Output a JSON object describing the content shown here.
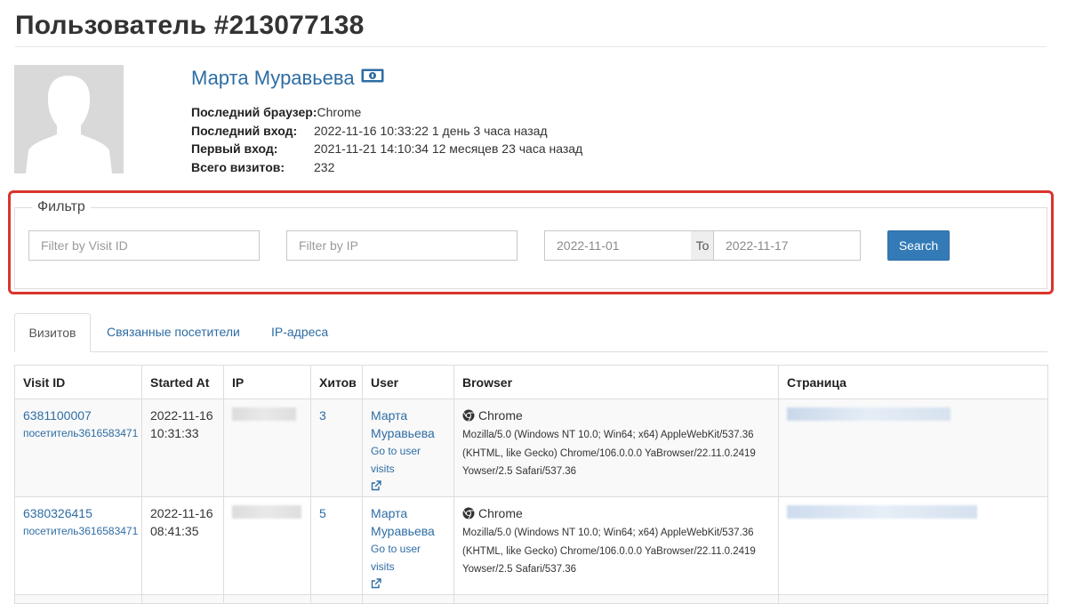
{
  "page": {
    "title": "Пользователь #213077138"
  },
  "user": {
    "name": "Марта Муравьева",
    "info": [
      {
        "label": "Последний браузер:",
        "value": "Chrome"
      },
      {
        "label": "Последний вход:",
        "value": "2022-11-16 10:33:22 1 день 3 часа назад"
      },
      {
        "label": "Первый вход:",
        "value": "2021-11-21 14:10:34 12 месяцев 23 часа назад"
      },
      {
        "label": "Всего визитов:",
        "value": "232"
      }
    ]
  },
  "filter": {
    "legend": "Фильтр",
    "visit_id_placeholder": "Filter by Visit ID",
    "ip_placeholder": "Filter by IP",
    "date_from": "2022-11-01",
    "date_sep": "To",
    "date_to": "2022-11-17",
    "search_label": "Search"
  },
  "tabs": [
    {
      "label": "Визитов",
      "active": true
    },
    {
      "label": "Связанные посетители",
      "active": false
    },
    {
      "label": "IP-адреса",
      "active": false
    }
  ],
  "table": {
    "columns": [
      "Visit ID",
      "Started At",
      "IP",
      "Хитов",
      "User",
      "Browser",
      "Страница"
    ],
    "rows": [
      {
        "visit_id": "6381100007",
        "visitor": "посетитель3616583471",
        "date": "2022-11-16",
        "time": "10:31:33",
        "hits": "3",
        "user_first": "Марта",
        "user_last": "Муравьева",
        "user_link": "Go to user visits",
        "browser": "Chrome",
        "ua1": "Mozilla/5.0 (Windows NT 10.0; Win64; x64) AppleWebKit/537.36",
        "ua2": "(KHTML, like Gecko) Chrome/106.0.0.0 YaBrowser/22.11.0.2419",
        "ua3": "Yowser/2.5 Safari/537.36"
      },
      {
        "visit_id": "6380326415",
        "visitor": "посетитель3616583471",
        "date": "2022-11-16",
        "time": "08:41:35",
        "hits": "5",
        "user_first": "Марта",
        "user_last": "Муравьева",
        "user_link": "Go to user visits",
        "browser": "Chrome",
        "ua1": "Mozilla/5.0 (Windows NT 10.0; Win64; x64) AppleWebKit/537.36",
        "ua2": "(KHTML, like Gecko) Chrome/106.0.0.0 YaBrowser/22.11.0.2419",
        "ua3": "Yowser/2.5 Safari/537.36"
      }
    ]
  },
  "colors": {
    "link": "#2e6da4",
    "primary_button": "#337ab7",
    "highlight": "#d9352c"
  },
  "icons": {
    "name_badge": "money-icon",
    "browser": "chrome-icon",
    "user_link": "external-link-icon",
    "avatar": "user-placeholder-icon"
  }
}
